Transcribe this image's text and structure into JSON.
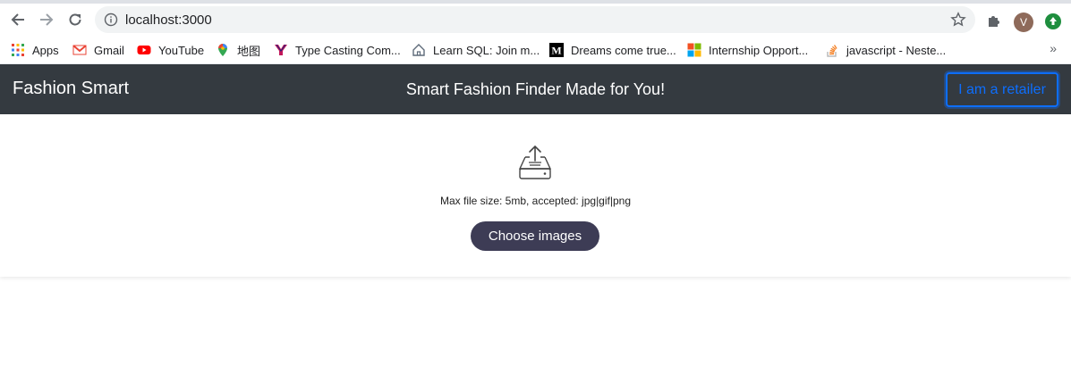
{
  "browser": {
    "url": "localhost:3000",
    "avatar_letter": "V",
    "bookmarks": [
      {
        "label": "Apps",
        "icon": "apps-grid-icon"
      },
      {
        "label": "Gmail",
        "icon": "gmail-icon"
      },
      {
        "label": "YouTube",
        "icon": "youtube-icon"
      },
      {
        "label": "地图",
        "icon": "maps-icon"
      },
      {
        "label": "Type Casting Com...",
        "icon": "bookmark-y-icon"
      },
      {
        "label": "Learn SQL: Join m...",
        "icon": "house-icon"
      },
      {
        "label": "Dreams come true...",
        "icon": "medium-icon"
      },
      {
        "label": "Internship Opport...",
        "icon": "microsoft-icon"
      },
      {
        "label": "javascript - Neste...",
        "icon": "stackoverflow-icon"
      }
    ],
    "more_label": "»"
  },
  "navbar": {
    "brand": "Fashion Smart",
    "tagline": "Smart Fashion Finder Made for You!",
    "retailer_button": "I am a retailer"
  },
  "upload": {
    "hint": "Max file size: 5mb, accepted: jpg|gif|png",
    "button_label": "Choose images",
    "icon": "upload-tray-icon"
  },
  "colors": {
    "navbar_bg": "#343a40",
    "retailer_accent": "#0d6efd",
    "choose_button_bg": "#3d3c55"
  }
}
